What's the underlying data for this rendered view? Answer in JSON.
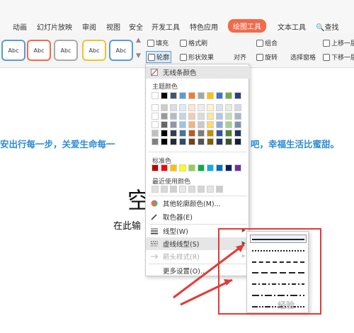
{
  "tabs": [
    "动画",
    "幻灯片放映",
    "审阅",
    "视图",
    "安全",
    "开发工具",
    "特色应用",
    "绘图工具",
    "文本工具",
    "查找"
  ],
  "active_tab": "绘图工具",
  "styles": [
    "Abc",
    "Abc",
    "Abc",
    "Abc",
    "Abc"
  ],
  "style_border_colors": [
    "#5b9bd5",
    "#f26a4b",
    "#aaaaaa",
    "#f2c12e",
    "#5b9bd5"
  ],
  "ribbon": {
    "fill": "填充",
    "format_brush": "格式刷",
    "outline": "轮廓",
    "shape_effect": "形状效果",
    "align": "对齐",
    "group": "组合",
    "rotate": "旋转",
    "selection_pane": "选择窗格",
    "move_up": "上移一层",
    "move_down": "下移一层"
  },
  "slide": {
    "banner_left": "安出行每一步，关爱生命每一",
    "banner_right": "吧，幸福生活比蜜甜。",
    "title": "空",
    "subtitle": "在此输"
  },
  "menu": {
    "no_line": "无线条颜色",
    "theme_colors_label": "主题颜色",
    "standard_colors_label": "标准色",
    "recent_colors_label": "最近使用颜色",
    "more_colors": "其他轮廓颜色(M)...",
    "eyedropper": "取色器(E)",
    "line_type": "线型(W)",
    "dash_type": "虚线线型(S)",
    "arrow_style": "箭头样式(R)",
    "more_settings": "更多设置(O)..."
  },
  "theme_top": [
    "#ffffff",
    "#000000",
    "#44546a",
    "#5b9bd5",
    "#ed7d31",
    "#a5a5a5",
    "#ffc000",
    "#4472c4",
    "#70ad47",
    "#264478"
  ],
  "standard_colors": [
    "#c00000",
    "#ff0000",
    "#ffc000",
    "#ffff00",
    "#92d050",
    "#00b050",
    "#00b0f0",
    "#0070c0",
    "#002060",
    "#7030a0"
  ],
  "recent_colors": [
    "#e0e0e0",
    "#d8d8d8",
    "#d0d0d0",
    "#e8e8e8",
    "#dcdcdc",
    "#d4d4d4",
    "#e4e4e4",
    "#cccccc"
  ],
  "watermark": "经验",
  "dash_styles": [
    "solid",
    "dotted",
    "dashed",
    "long-dash",
    "dash-dot",
    "long-dash-dot",
    "dash-dot-dot"
  ]
}
